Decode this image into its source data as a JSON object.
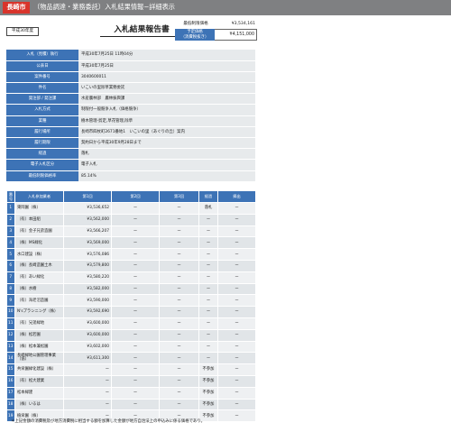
{
  "header": {
    "city": "長崎市",
    "title": "（物品調達・業務委託）入札結果情報−詳細表示"
  },
  "era_badge": "平成30年度",
  "report_title": "入札結果報告書",
  "prices": {
    "max_label": "最低制限価格",
    "max_value": "¥3,534,161",
    "planned_label_1": "予定価格",
    "planned_label_2": "（消費税抜き）",
    "planned_value": "¥4,151,000"
  },
  "info_rows": [
    {
      "label": "入札（見積）執行",
      "value": "平成30年7月25日 11時04分"
    },
    {
      "label": "公表日",
      "value": "平成30年7月25日"
    },
    {
      "label": "案件番号",
      "value": "3040600011"
    },
    {
      "label": "件名",
      "value": "いこいの里除草業務委託"
    },
    {
      "label": "発注部 / 発注課",
      "value": "水産農林部　農林振興課"
    },
    {
      "label": "入札方式",
      "value": "制限付一般競争入札（価格競争）"
    },
    {
      "label": "業種",
      "value": "樹木管理-剪定,草花管理,除草"
    },
    {
      "label": "履行場所",
      "value": "長崎市四杖町2671番地1　いこいの里（あぐりの丘）案内"
    },
    {
      "label": "履行期限",
      "value": "契約日から平成30年9月28日まで"
    },
    {
      "label": "経過",
      "value": "落札"
    },
    {
      "label": "電子入札区分",
      "value": "電子入札"
    },
    {
      "label": "最低制限価格率",
      "value": "85.14%"
    }
  ],
  "bid_headers": [
    "番号",
    "入札参加業者",
    "第1回",
    "第2回",
    "第3回",
    "経過",
    "摘出"
  ],
  "bids": [
    {
      "no": "1",
      "name": "東岡園（株）",
      "r1": "¥3,536,652",
      "r2": "ー",
      "r3": "ー",
      "status": "落札",
      "note": "ー"
    },
    {
      "no": "2",
      "name": "（有）本田組",
      "r1": "¥3,562,000",
      "r2": "ー",
      "r3": "ー",
      "status": "ー",
      "note": "ー"
    },
    {
      "no": "3",
      "name": "（有）金子兄弟造園",
      "r1": "¥3,566,207",
      "r2": "ー",
      "r3": "ー",
      "status": "ー",
      "note": "ー"
    },
    {
      "no": "4",
      "name": "（株）MS緑化",
      "r1": "¥3,569,000",
      "r2": "ー",
      "r3": "ー",
      "status": "ー",
      "note": "ー"
    },
    {
      "no": "5",
      "name": "水口建設（株）",
      "r1": "¥3,576,086",
      "r2": "ー",
      "r3": "ー",
      "status": "ー",
      "note": "ー"
    },
    {
      "no": "6",
      "name": "（株）長崎造園土木",
      "r1": "¥3,579,800",
      "r2": "ー",
      "r3": "ー",
      "status": "ー",
      "note": "ー"
    },
    {
      "no": "7",
      "name": "（有）あい緑化",
      "r1": "¥3,580,220",
      "r2": "ー",
      "r3": "ー",
      "status": "ー",
      "note": "ー"
    },
    {
      "no": "8",
      "name": "（株）水樹",
      "r1": "¥3,582,000",
      "r2": "ー",
      "r3": "ー",
      "status": "ー",
      "note": "ー"
    },
    {
      "no": "9",
      "name": "（有）海老沼造園",
      "r1": "¥3,590,000",
      "r2": "ー",
      "r3": "ー",
      "status": "ー",
      "note": "ー"
    },
    {
      "no": "10",
      "name": "N'sプランニング（株）",
      "r1": "¥3,592,690",
      "r2": "ー",
      "r3": "ー",
      "status": "ー",
      "note": "ー"
    },
    {
      "no": "11",
      "name": "（有）兄弟緑地",
      "r1": "¥3,600,000",
      "r2": "ー",
      "r3": "ー",
      "status": "ー",
      "note": "ー"
    },
    {
      "no": "12",
      "name": "（株）松若園",
      "r1": "¥3,600,000",
      "r2": "ー",
      "r3": "ー",
      "status": "ー",
      "note": "ー"
    },
    {
      "no": "13",
      "name": "（株）松本兼松園",
      "r1": "¥3,602,000",
      "r2": "ー",
      "r3": "ー",
      "status": "ー",
      "note": "ー"
    },
    {
      "no": "14",
      "name": "長崎緑地公園管理事業（協）",
      "r1": "¥3,611,300",
      "r2": "ー",
      "r3": "ー",
      "status": "ー",
      "note": "ー"
    },
    {
      "no": "15",
      "name": "共栄園緑化建設（株）",
      "r1": "ー",
      "r2": "ー",
      "r3": "ー",
      "status": "不参加",
      "note": "ー"
    },
    {
      "no": "16",
      "name": "（有）松大建業",
      "r1": "ー",
      "r2": "ー",
      "r3": "ー",
      "status": "不参加",
      "note": "ー"
    },
    {
      "no": "17",
      "name": "松本緑建",
      "r1": "ー",
      "r2": "ー",
      "r3": "ー",
      "status": "不参加",
      "note": "ー"
    },
    {
      "no": "18",
      "name": "（株）いるは",
      "r1": "ー",
      "r2": "ー",
      "r3": "ー",
      "status": "不参加",
      "note": "ー"
    },
    {
      "no": "19",
      "name": "植栄園（株）",
      "r1": "ー",
      "r2": "ー",
      "r3": "ー",
      "status": "不参加",
      "note": "ー"
    }
  ],
  "footnote": "＊上記金額の消費税及び地方消費税に相当する額を加算した金額が地方自治法上の申込みに係る価格であり。"
}
